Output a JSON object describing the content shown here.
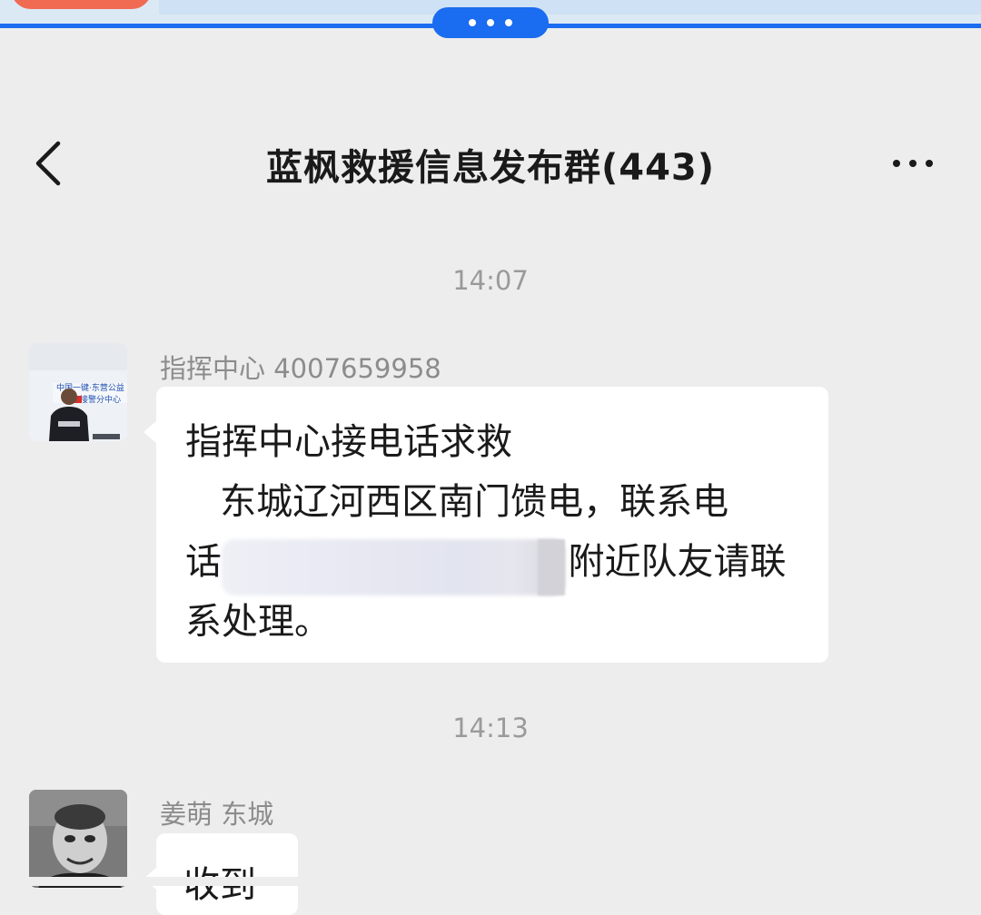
{
  "header": {
    "title": "蓝枫救援信息发布群(443)"
  },
  "messages": [
    {
      "timestamp": "14:07",
      "sender": "指挥中心 4007659958",
      "avatar": {
        "caption_line1": "中国一键·东营公益",
        "caption_line2": "接警分中心"
      },
      "text": "指挥中心接电话求救\n   东城辽河西区南门馈电，联系电\n话                              附近队友请联\n系处理。"
    },
    {
      "timestamp": "14:13",
      "sender": "姜萌 东城",
      "text": "收到"
    }
  ],
  "colors": {
    "accent": "#1a6cf0",
    "chat_background": "#ededed",
    "bubble": "#ffffff",
    "secondary_text": "#8c8c8c"
  },
  "icons": {
    "back": "chevron-left-icon",
    "more": "more-dots-icon",
    "handle": "drag-handle-icon"
  }
}
